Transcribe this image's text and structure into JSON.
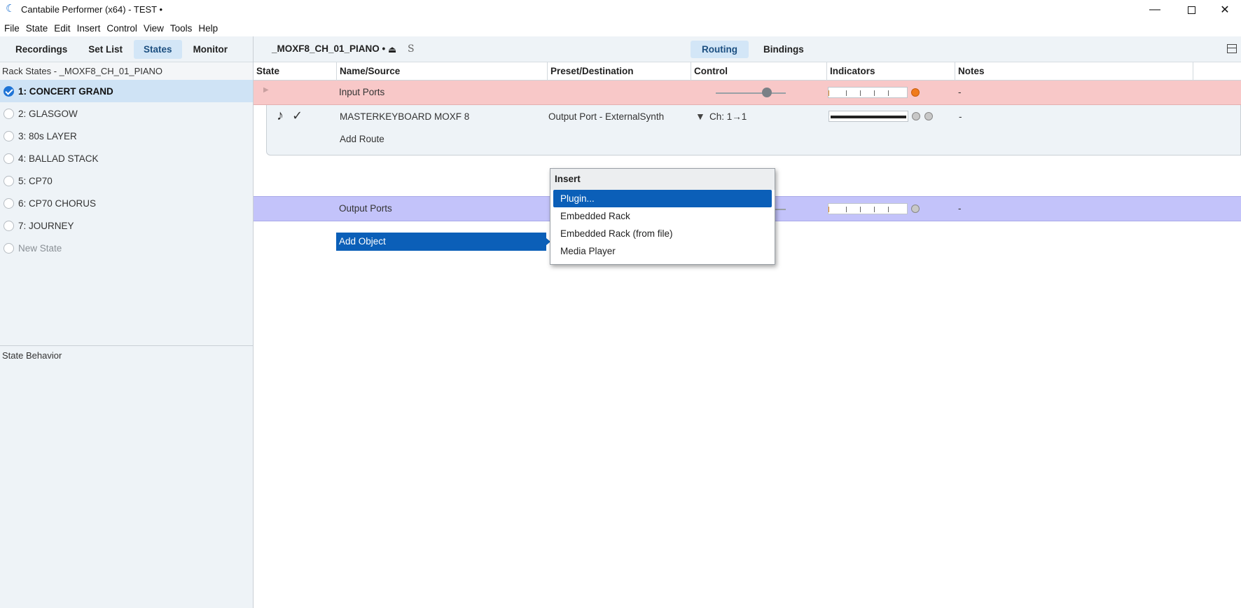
{
  "window": {
    "title": "Cantabile Performer (x64) - TEST •",
    "icon": "cantabile-logo-icon"
  },
  "menu": [
    "File",
    "State",
    "Edit",
    "Insert",
    "Control",
    "View",
    "Tools",
    "Help"
  ],
  "left_tabs": [
    {
      "label": "Recordings",
      "active": false
    },
    {
      "label": "Set List",
      "active": false
    },
    {
      "label": "States",
      "active": true
    },
    {
      "label": "Monitor",
      "active": false
    }
  ],
  "rack_states_header": "Rack States - _MOXF8_CH_01_PIANO",
  "states": [
    {
      "label": "1: CONCERT GRAND",
      "active": true
    },
    {
      "label": "2: GLASGOW",
      "active": false
    },
    {
      "label": "3: 80s LAYER",
      "active": false
    },
    {
      "label": "4: BALLAD STACK",
      "active": false
    },
    {
      "label": "5: CP70",
      "active": false
    },
    {
      "label": "6: CP70 CHORUS",
      "active": false
    },
    {
      "label": "7: JOURNEY",
      "active": false
    }
  ],
  "new_state_label": "New State",
  "state_behavior_label": "State Behavior",
  "rack": {
    "name": "_MOXF8_CH_01_PIANO •",
    "s_label": "S"
  },
  "right_tabs": [
    {
      "label": "Routing",
      "active": true
    },
    {
      "label": "Bindings",
      "active": false
    }
  ],
  "columns": [
    "State",
    "Name/Source",
    "Preset/Destination",
    "Control",
    "Indicators",
    "Notes"
  ],
  "input_ports": {
    "name": "Input Ports",
    "notes": "-"
  },
  "route": {
    "name": "MASTERKEYBOARD MOXF 8",
    "destination": "Output Port - ExternalSynth",
    "channel": "Ch: 1→1",
    "notes": "-"
  },
  "add_route_label": "Add Route",
  "output_ports": {
    "name": "Output Ports",
    "notes": "-"
  },
  "add_object_label": "Add Object",
  "insert_menu": {
    "header": "Insert",
    "items": [
      {
        "label": "Plugin...",
        "selected": true
      },
      {
        "label": "Embedded Rack",
        "selected": false
      },
      {
        "label": "Embedded Rack (from file)",
        "selected": false
      },
      {
        "label": "Media Player",
        "selected": false
      }
    ]
  }
}
